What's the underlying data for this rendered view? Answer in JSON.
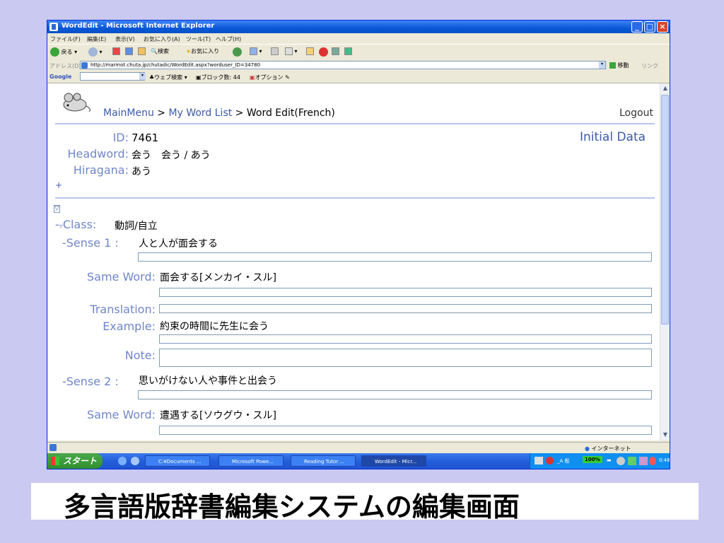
{
  "window": {
    "title": "WordEdit - Microsoft Internet Explorer",
    "min_glyph": "_",
    "max_glyph": "□",
    "close_glyph": "×"
  },
  "menubar": [
    "ファイル(F)",
    "編集(E)",
    "表示(V)",
    "お気に入り(A)",
    "ツール(T)",
    "ヘルプ(H)"
  ],
  "toolbar": {
    "back_label": "戻る",
    "search_label": "検索",
    "favorites_label": "お気に入り"
  },
  "address": {
    "label": "アドレス(D)",
    "url": "http://marmot.chuta.jp/chutadic/WordEdit.aspx?worduser_ID=34780",
    "go_label": "移動",
    "links_label": "リンク"
  },
  "googlebar": {
    "logo": "Google",
    "web_search": "ウェブ検索",
    "blocked": "ブロック数: 44",
    "options": "オプション"
  },
  "page": {
    "breadcrumb": {
      "main_menu": "MainMenu",
      "sep1": " > ",
      "my_word_list": "My Word List",
      "sep2": " > ",
      "current": "Word Edit(French)"
    },
    "logout": "Logout",
    "initial_data": "Initial Data",
    "id_label": "ID:",
    "id_value": "7461",
    "headword_label": "Headword:",
    "headword_value": "会う　会う / あう",
    "hiragana_label": "Hiragana:",
    "hiragana_value": "あう",
    "plus": "+",
    "toggle_glyph": "▽",
    "class_prefix": "-",
    "class_label": "Class:",
    "class_value": "動詞/自立",
    "senses": [
      {
        "label": "-Sense 1 :",
        "text": "人と人が面会する",
        "same_word_label": "Same Word:",
        "same_word": "面会する[メンカイ・スル]",
        "translation_label": "Translation:",
        "example_label": "Example:",
        "example": "約束の時間に先生に会う",
        "note_label": "Note:"
      },
      {
        "label": "-Sense 2 :",
        "text": "思いがけない人や事件と出会う",
        "same_word_label": "Same Word:",
        "same_word": "遭遇する[ソウグウ・スル]"
      }
    ]
  },
  "statusbar": {
    "zone": "インターネット"
  },
  "taskbar": {
    "start": "スタート",
    "tasks": [
      "C:¥Documents ...",
      "Microsoft Powe...",
      "Reading Tutor ...",
      "WordEdit - Micr..."
    ],
    "ime": "_A 般",
    "zoom": "100%",
    "clock": "0:48"
  },
  "caption": "多言語版辞書編集システムの編集画面",
  "colors": {
    "label_blue": "#6f86c8",
    "link_blue": "#3b5aa8",
    "rule": "#b9c4ee",
    "slide_bg": "#c9c9f1"
  }
}
